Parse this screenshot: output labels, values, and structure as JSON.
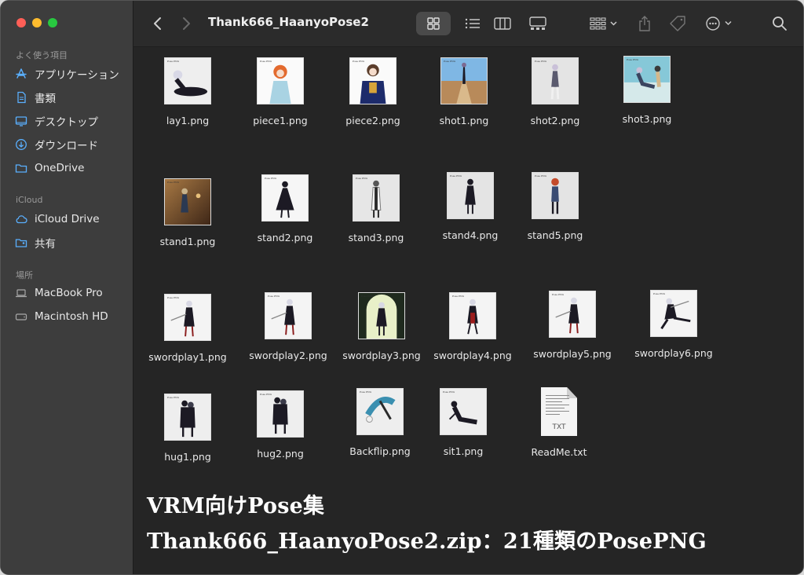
{
  "window": {
    "title": "Thank666_HaanyoPose2"
  },
  "sidebar": {
    "favorites_header": "よく使う項目",
    "favorites": [
      {
        "label": "アプリケーション",
        "icon": "applications-icon"
      },
      {
        "label": "書類",
        "icon": "document-icon"
      },
      {
        "label": "デスクトップ",
        "icon": "desktop-icon"
      },
      {
        "label": "ダウンロード",
        "icon": "download-icon"
      },
      {
        "label": "OneDrive",
        "icon": "folder-icon"
      }
    ],
    "icloud_header": "iCloud",
    "icloud": [
      {
        "label": "iCloud Drive",
        "icon": "cloud-icon"
      },
      {
        "label": "共有",
        "icon": "shared-folder-icon"
      }
    ],
    "locations_header": "場所",
    "locations": [
      {
        "label": "MacBook Pro",
        "icon": "laptop-icon"
      },
      {
        "label": "Macintosh HD",
        "icon": "disk-icon"
      }
    ]
  },
  "toolbar": {
    "icons": [
      "back-icon",
      "forward-icon",
      "grid-view-icon",
      "list-view-icon",
      "column-view-icon",
      "gallery-view-icon",
      "group-icon",
      "share-icon",
      "tag-icon",
      "more-icon",
      "search-icon"
    ]
  },
  "files": [
    {
      "name": "lay1.png",
      "art": "lay"
    },
    {
      "name": "piece1.png",
      "art": "piece-blue"
    },
    {
      "name": "piece2.png",
      "art": "piece-navy"
    },
    {
      "name": "shot1.png",
      "art": "pier"
    },
    {
      "name": "shot2.png",
      "art": "stand-grey"
    },
    {
      "name": "shot3.png",
      "art": "sit-beach"
    },
    {
      "name": "stand1.png",
      "art": "stand-warm"
    },
    {
      "name": "stand2.png",
      "art": "stand-dress"
    },
    {
      "name": "stand3.png",
      "art": "stand-coat"
    },
    {
      "name": "stand4.png",
      "art": "stand-dark"
    },
    {
      "name": "stand5.png",
      "art": "stand-red"
    },
    {
      "name": "swordplay1.png",
      "art": "sword"
    },
    {
      "name": "swordplay2.png",
      "art": "sword"
    },
    {
      "name": "swordplay3.png",
      "art": "sword-arch"
    },
    {
      "name": "swordplay4.png",
      "art": "sword-red"
    },
    {
      "name": "swordplay5.png",
      "art": "sword"
    },
    {
      "name": "swordplay6.png",
      "art": "sword-lunge"
    },
    {
      "name": "hug1.png",
      "art": "hug"
    },
    {
      "name": "hug2.png",
      "art": "hug"
    },
    {
      "name": "Backflip.png",
      "art": "flip"
    },
    {
      "name": "sit1.png",
      "art": "sit"
    },
    {
      "name": "ReadMe.txt",
      "art": "txt"
    }
  ],
  "thumb_label": "Pose PNG",
  "txt_ext": "TXT",
  "caption": {
    "line1": "VRM向けPose集",
    "line2": "Thank666_HaanyoPose2.zip：21種類のPosePNG"
  }
}
